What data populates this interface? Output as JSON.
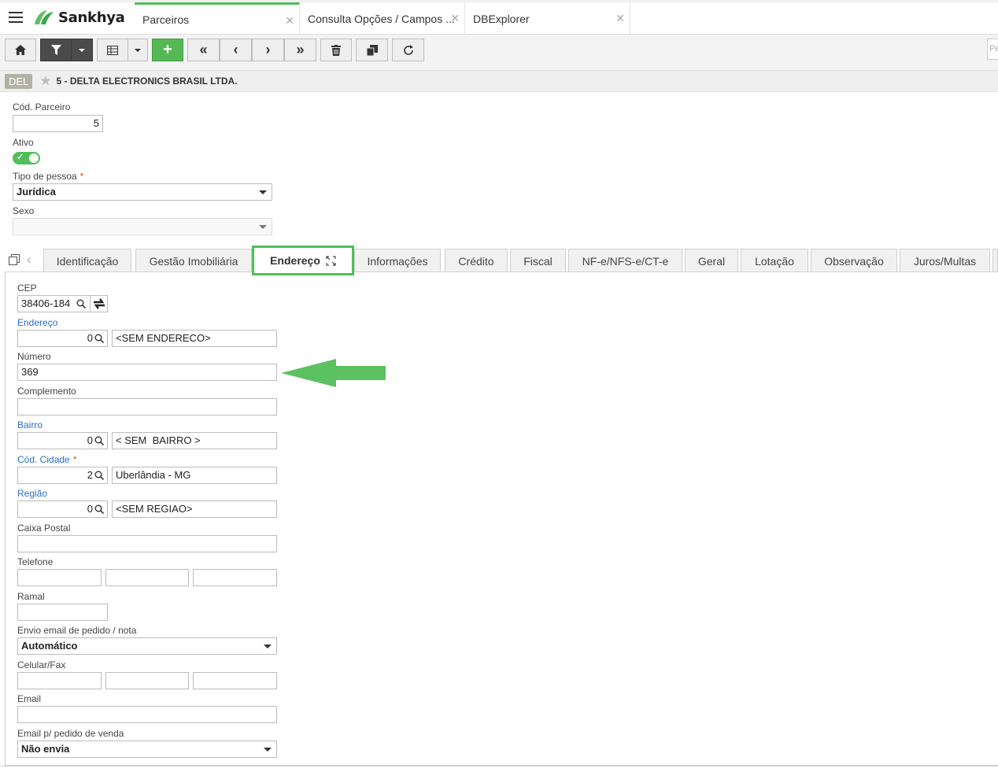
{
  "app": {
    "brand": "Sankhya",
    "tabs": [
      {
        "label": "Parceiros",
        "active": true
      },
      {
        "label": "Consulta Opções / Campos ..."
      },
      {
        "label": "DBExplorer"
      }
    ],
    "search_placeholder": "Pe"
  },
  "record": {
    "badge": "DEL",
    "title": "5 - DELTA ELECTRONICS BRASIL LTDA."
  },
  "form": {
    "cod_parceiro_label": "Cód. Parceiro",
    "cod_parceiro_value": "5",
    "ativo_label": "Ativo",
    "ativo_value": true,
    "tipo_pessoa_label": "Tipo de pessoa",
    "tipo_pessoa_value": "Jurídica",
    "sexo_label": "Sexo",
    "sexo_value": ""
  },
  "detail_tabs": [
    "Identificação",
    "Gestão Imobiliária",
    "Endereço",
    "Informações",
    "Crédito",
    "Fiscal",
    "NF-e/NFS-e/CT-e",
    "Geral",
    "Lotação",
    "Observação",
    "Juros/Multas"
  ],
  "active_tab": "Endereço",
  "endereco": {
    "cep_label": "CEP",
    "cep_value": "38406-184",
    "endereco_label": "Endereço",
    "endereco_code": "0",
    "endereco_desc": "<SEM ENDERECO>",
    "numero_label": "Número",
    "numero_value": "369",
    "complemento_label": "Complemento",
    "complemento_value": "",
    "bairro_label": "Bairro",
    "bairro_code": "0",
    "bairro_desc": "< SEM  BAIRRO >",
    "cidade_label": "Cód. Cidade",
    "cidade_code": "2",
    "cidade_desc": "Uberlândia - MG",
    "regiao_label": "Região",
    "regiao_code": "0",
    "regiao_desc": "<SEM REGIAO>",
    "caixa_postal_label": "Caixa Postal",
    "telefone_label": "Telefone",
    "ramal_label": "Ramal",
    "envio_email_label": "Envio email de pedido / nota",
    "envio_email_value": "Automático",
    "celular_label": "Celular/Fax",
    "email_label": "Email",
    "email_pedido_label": "Email p/ pedido de venda",
    "email_pedido_value": "Não envia"
  },
  "colors": {
    "accent_green": "#4fbf58",
    "arrow_green": "#5cc160",
    "link_blue": "#2a6fc9",
    "required_red": "#e2492a"
  }
}
